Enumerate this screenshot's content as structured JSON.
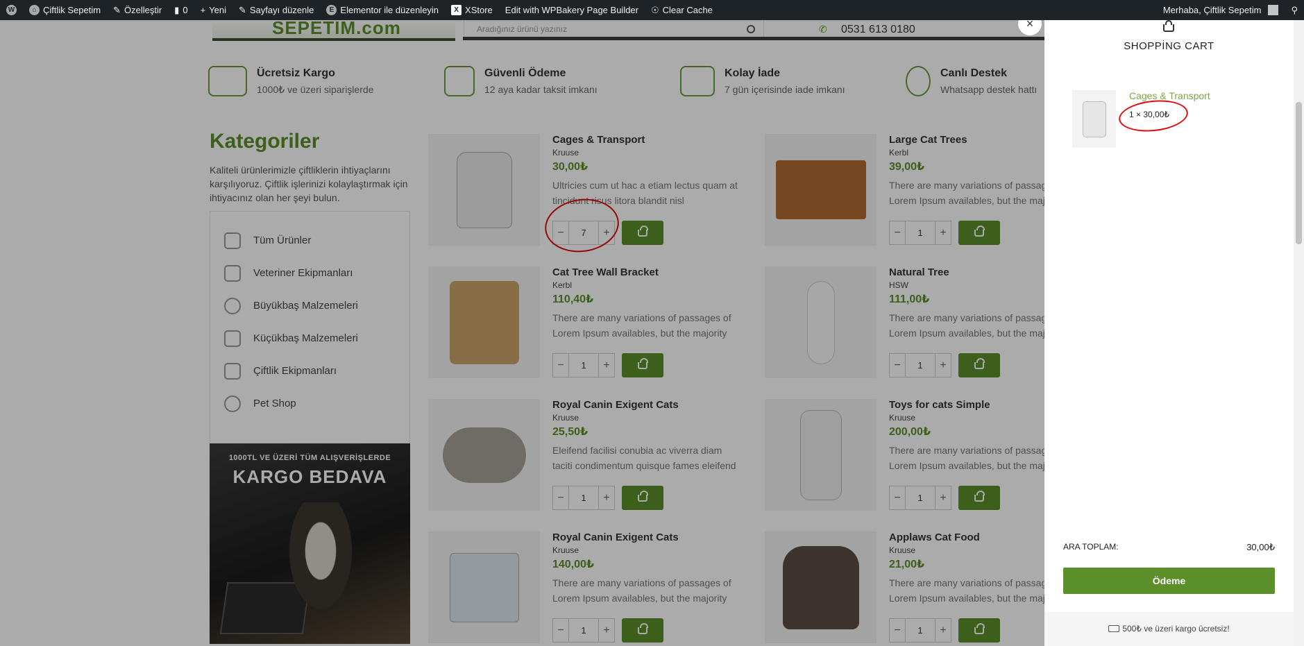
{
  "adminbar": {
    "site_name": "Çiftlik Sepetim",
    "customize": "Özelleştir",
    "comments_count": "0",
    "new": "Yeni",
    "edit_page": "Sayfayı düzenle",
    "elementor": "Elementor ile düzenleyin",
    "xstore": "XStore",
    "wpbakery": "Edit with WPBakery Page Builder",
    "clear_cache": "Clear Cache",
    "greeting": "Merhaba, Çiftlik Sepetim"
  },
  "header": {
    "logo_text": "SEPETIM.com",
    "search_placeholder": "Aradığınız ürünü yazınız",
    "phone": "0531 613 0180"
  },
  "features": [
    {
      "title": "Ücretsiz Kargo",
      "subtitle": "1000₺ ve üzeri siparişlerde"
    },
    {
      "title": "Güvenli Ödeme",
      "subtitle": "12 aya kadar taksit imkanı"
    },
    {
      "title": "Kolay İade",
      "subtitle": "7 gün içerisinde iade imkanı"
    },
    {
      "title": "Canlı Destek",
      "subtitle": "Whatsapp destek hattı"
    }
  ],
  "categories": {
    "title": "Kategoriler",
    "description": "Kaliteli ürünlerimizle çiftliklerin ihtiyaçlarını karşılıyoruz. Çiftlik işlerinizi kolaylaştırmak için ihtiyacınız olan her şeyi bulun.",
    "items": [
      "Tüm Ürünler",
      "Veteriner Ekipmanları",
      "Büyükbaş Malzemeleri",
      "Küçükbaş Malzemeleri",
      "Çiftlik Ekipmanları",
      "Pet Shop"
    ]
  },
  "banner": {
    "line1": "1000TL VE ÜZERİ TÜM ALIŞVERİŞLERDE",
    "line2": "KARGO BEDAVA"
  },
  "products": [
    {
      "name": "Cages & Transport",
      "brand": "Kruuse",
      "price": "30,00₺",
      "desc1": "Ultricies cum ut hac a etiam lectus quam at",
      "desc2": "tincidunt risus litora blandit nisl",
      "qty": "7"
    },
    {
      "name": "Large Cat Trees",
      "brand": "Kerbl",
      "price": "39,00₺",
      "desc1": "There are many variations of passages of",
      "desc2": "Lorem Ipsum availables, but the majority",
      "qty": "1"
    },
    {
      "name": "Cat Tree Wall Bracket",
      "brand": "Kerbl",
      "price": "110,40₺",
      "desc1": "There are many variations of passages of",
      "desc2": "Lorem Ipsum availables, but the majority",
      "qty": "1"
    },
    {
      "name": "Natural Tree",
      "brand": "HSW",
      "price": "111,00₺",
      "desc1": "There are many variations of passages of",
      "desc2": "Lorem Ipsum availables, but the majority",
      "qty": "1"
    },
    {
      "name": "Royal Canin Exigent Cats",
      "brand": "Kruuse",
      "price": "25,50₺",
      "desc1": "Eleifend facilisi conubia ac viverra diam",
      "desc2": "taciti condimentum quisque fames eleifend",
      "qty": "1"
    },
    {
      "name": "Toys for cats Simple",
      "brand": "Kruuse",
      "price": "200,00₺",
      "desc1": "There are many variations of passages of",
      "desc2": "Lorem Ipsum availables, but the majority",
      "qty": "1"
    },
    {
      "name": "Royal Canin Exigent Cats",
      "brand": "Kruuse",
      "price": "140,00₺",
      "desc1": "There are many variations of passages of",
      "desc2": "Lorem Ipsum availables, but the majority",
      "qty": "1"
    },
    {
      "name": "Applaws Cat Food",
      "brand": "Kruuse",
      "price": "21,00₺",
      "desc1": "There are many variations of passages of",
      "desc2": "Lorem Ipsum availables, but the majority",
      "qty": "1"
    }
  ],
  "cart": {
    "title": "SHOPPİNG CART",
    "item_name": "Cages & Transport",
    "item_qty": "1 × 30,00₺",
    "subtotal_label": "ARA TOPLAM:",
    "subtotal_value": "30,00₺",
    "checkout_label": "Ödeme",
    "footer_note": "500₺ ve üzeri kargo ücretsiz!",
    "close_symbol": "×"
  },
  "colors": {
    "brand_green": "#5a8f29",
    "admin_bar": "#1d2327",
    "annotation_red": "#e10b0b"
  }
}
